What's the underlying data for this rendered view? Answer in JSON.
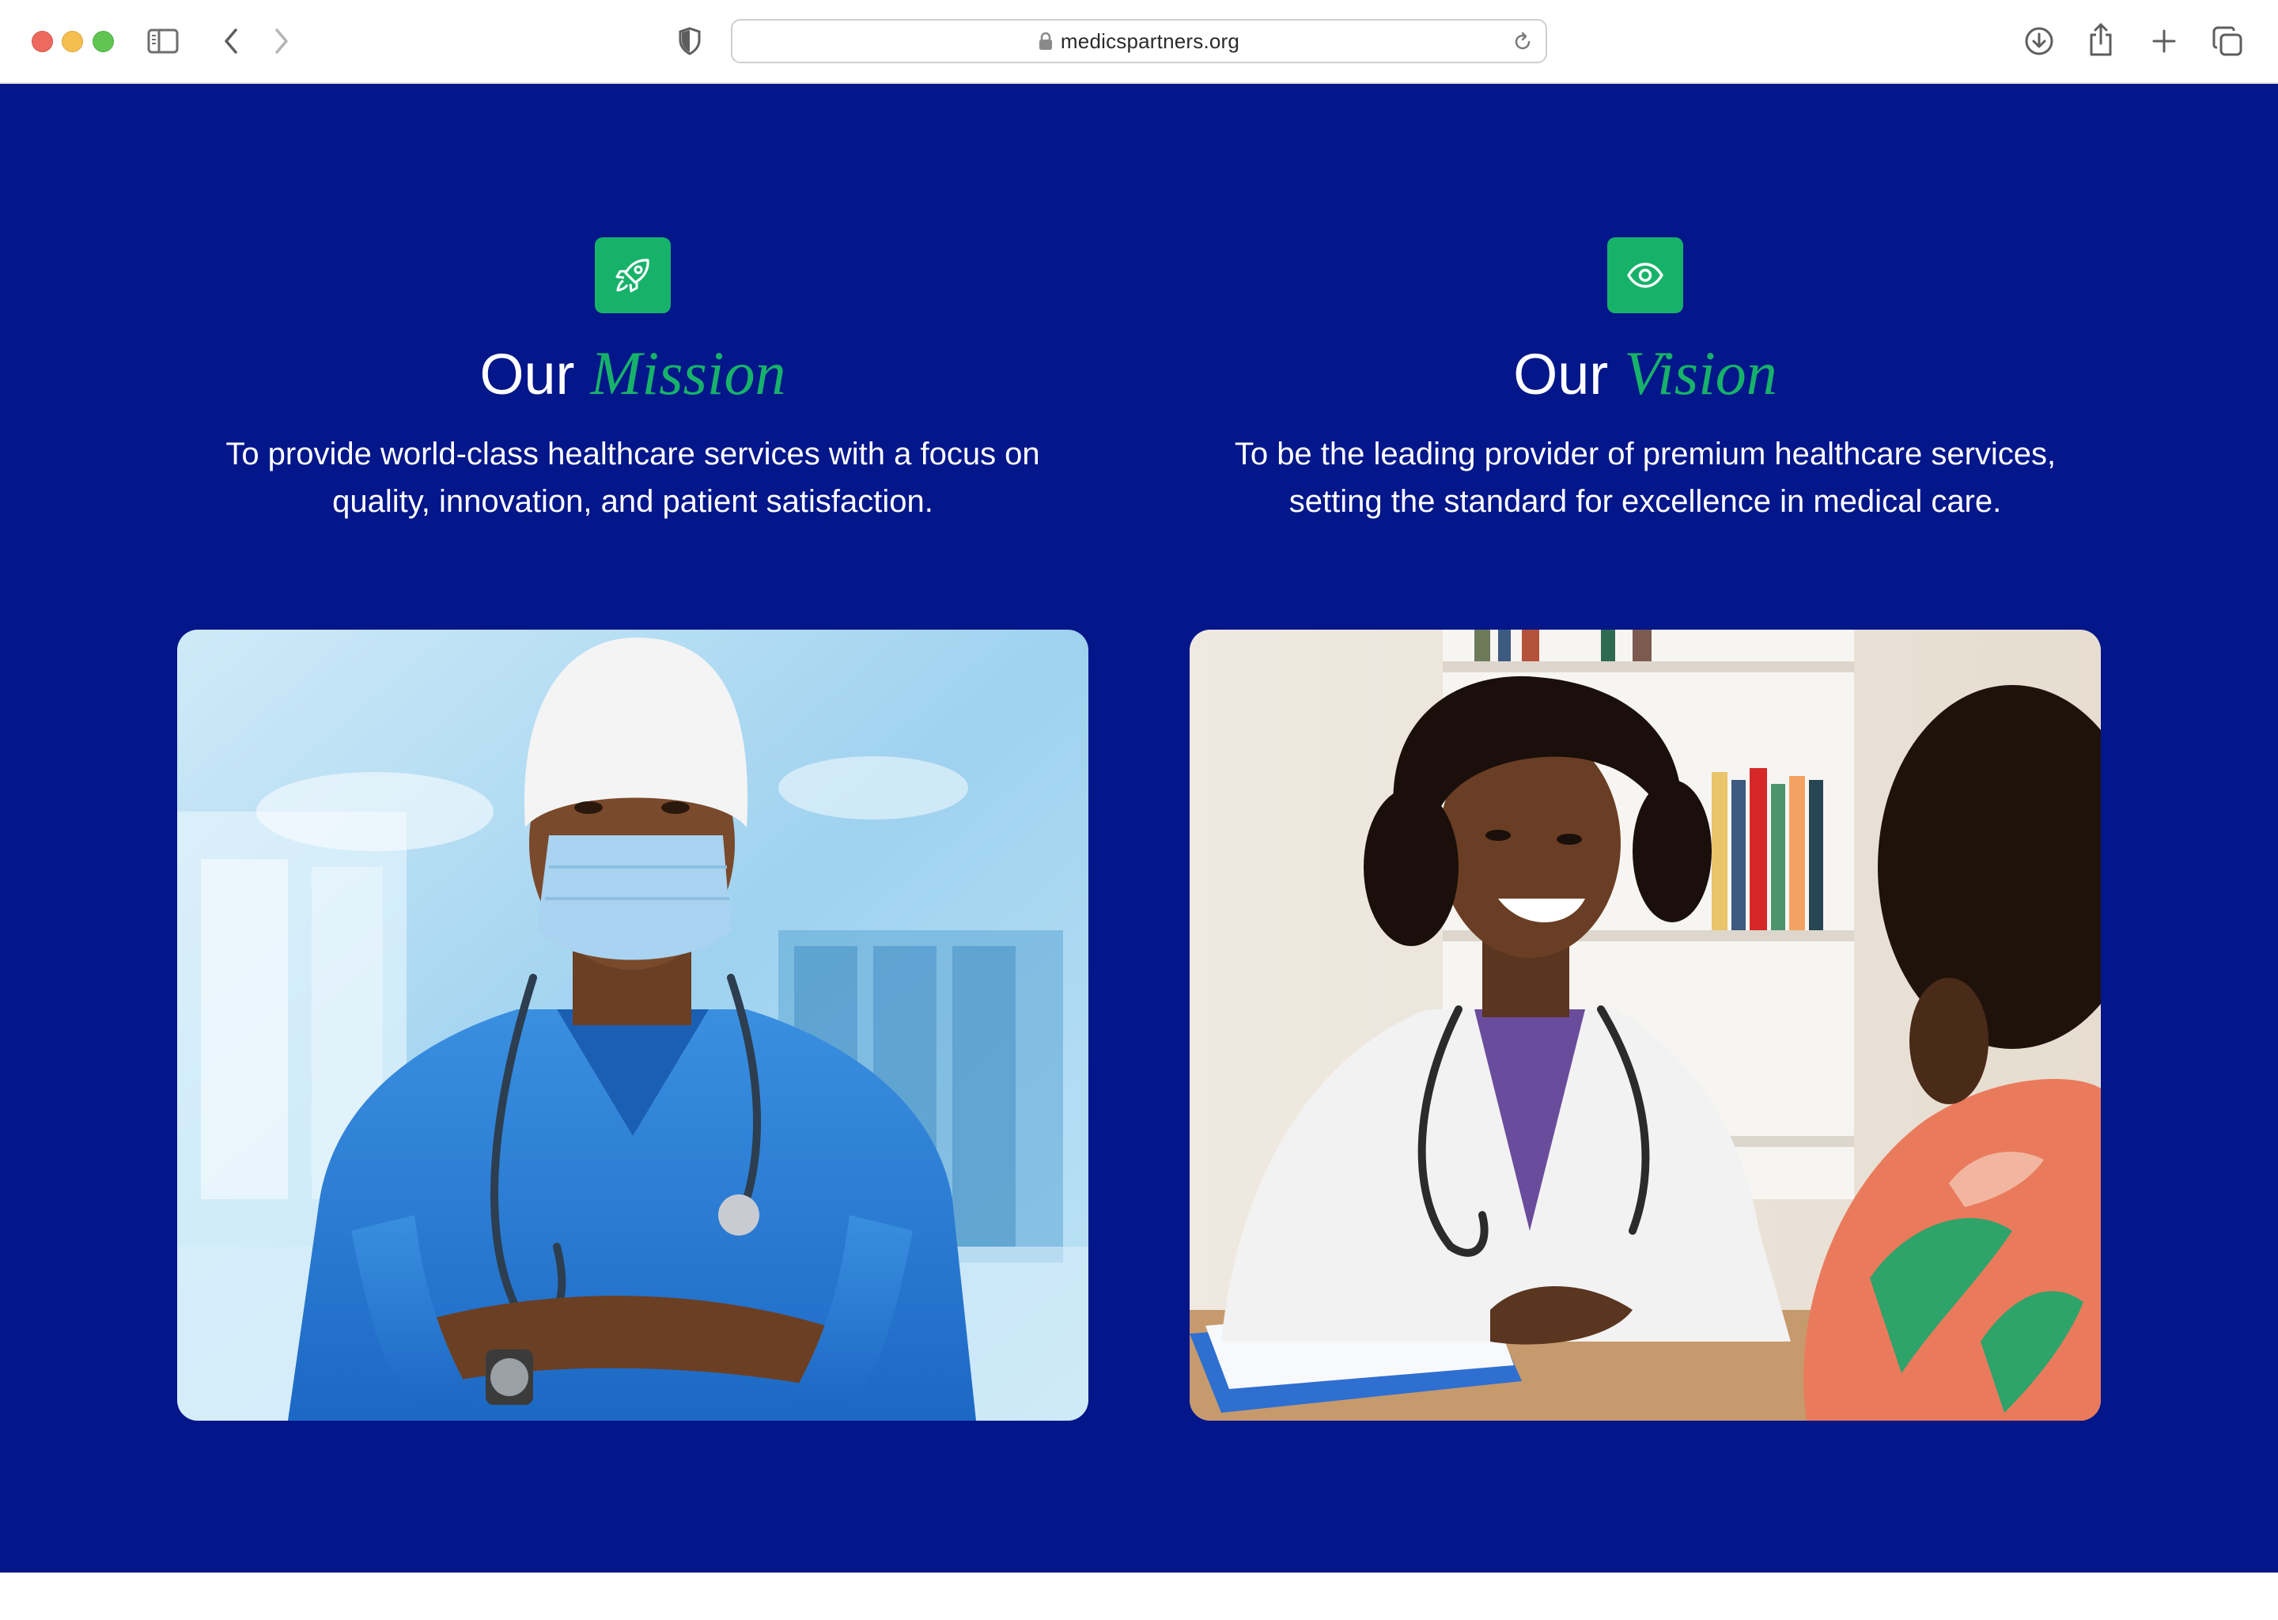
{
  "browser": {
    "url": "medicspartners.org"
  },
  "mission": {
    "heading_prefix": "Our",
    "heading_accent": "Mission",
    "description": "To provide world-class healthcare services with a focus on quality, innovation, and patient satisfaction.",
    "icon": "rocket-icon"
  },
  "vision": {
    "heading_prefix": "Our",
    "heading_accent": "Vision",
    "description": "To be the leading provider of premium healthcare services, setting the standard for excellence in medical care.",
    "icon": "eye-icon"
  },
  "colors": {
    "section_bg": "#03168a",
    "accent": "#17b26a",
    "text": "#ffffff"
  }
}
